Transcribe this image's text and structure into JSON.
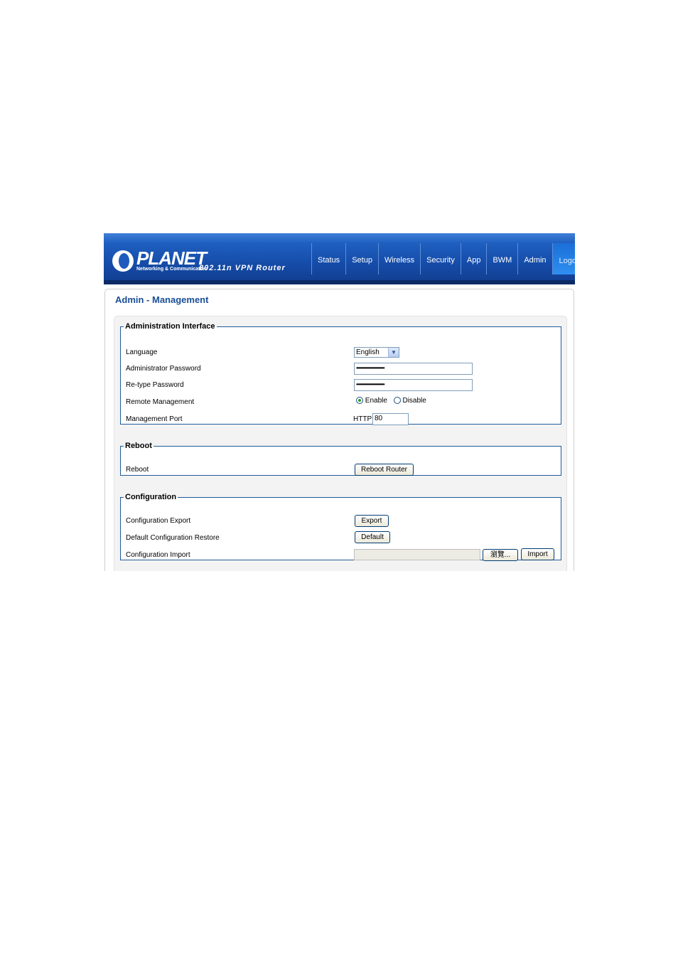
{
  "brand": {
    "name": "PLANET",
    "tagline": "Networking & Communication",
    "product": "802.11n VPN Router"
  },
  "nav": {
    "items": [
      "Status",
      "Setup",
      "Wireless",
      "Security",
      "App",
      "BWM",
      "Admin"
    ],
    "logout": "Logout"
  },
  "page": {
    "title": "Admin - Management"
  },
  "admin_interface": {
    "legend": "Administration Interface",
    "language_label": "Language",
    "language_value": "English",
    "admin_password_label": "Administrator Password",
    "admin_password_value": "••••••••••••••••••••••••••••",
    "retype_password_label": "Re-type Password",
    "retype_password_value": "••••••••••••••••••••••••••••",
    "remote_mgmt_label": "Remote Management",
    "enable_label": "Enable",
    "disable_label": "Disable",
    "remote_mgmt_selected": "Enable",
    "mgmt_port_label": "Management Port",
    "http_label": "HTTP",
    "http_port_value": "80"
  },
  "reboot": {
    "legend": "Reboot",
    "reboot_label": "Reboot",
    "reboot_button": "Reboot Router"
  },
  "configuration": {
    "legend": "Configuration",
    "export_label": "Configuration Export",
    "export_button": "Export",
    "default_label": "Default Configuration Restore",
    "default_button": "Default",
    "import_label": "Configuration Import",
    "browse_button": "瀏覽...",
    "import_button": "Import"
  },
  "colors": {
    "header_blue": "#164eab",
    "title_blue": "#1a4f96",
    "fieldset_border": "#1f5b99",
    "logout_bg": "#2f8ff0"
  }
}
